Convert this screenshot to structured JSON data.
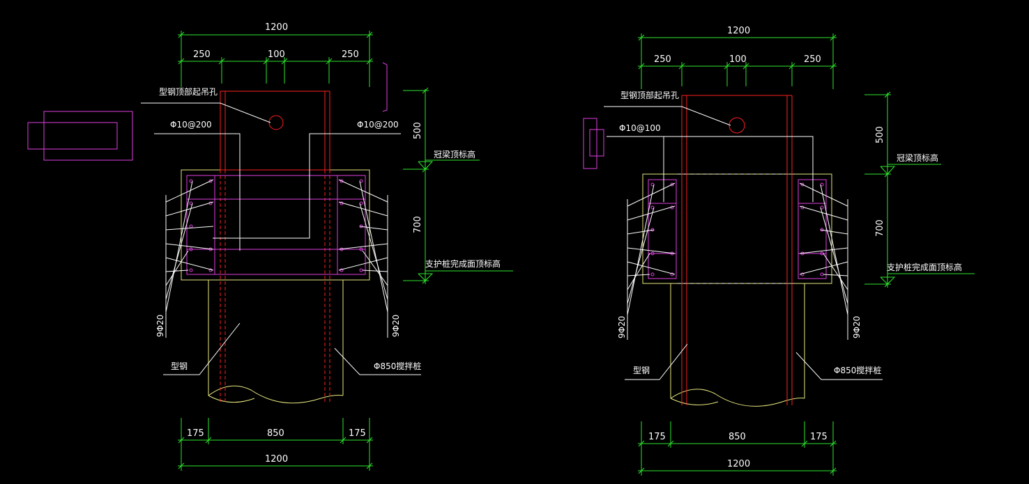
{
  "left": {
    "dim_top_total": "1200",
    "dim_top_a": "250",
    "dim_top_b": "100",
    "dim_top_c": "250",
    "dim_bot_a": "175",
    "dim_bot_b": "850",
    "dim_bot_c": "175",
    "dim_bot_total": "1200",
    "dim_right_upper": "500",
    "dim_right_lower": "700",
    "lift_hole": "型钢顶部起吊孔",
    "stirrup_left": "Φ10@200",
    "stirrup_right": "Φ10@200",
    "crown_beam_top": "冠梁顶标高",
    "pile_top": "支护桩完成面顶标高",
    "rebar_left": "9Φ20",
    "rebar_right": "9Φ20",
    "steel_section": "型钢",
    "mixing_pile": "Φ850搅拌桩"
  },
  "right": {
    "dim_top_total": "1200",
    "dim_top_a": "250",
    "dim_top_b": "100",
    "dim_top_c": "250",
    "dim_bot_a": "175",
    "dim_bot_b": "850",
    "dim_bot_c": "175",
    "dim_bot_total": "1200",
    "dim_right_upper": "500",
    "dim_right_lower": "700",
    "lift_hole": "型钢顶部起吊孔",
    "stirrup": "Φ10@100",
    "crown_beam_top": "冠梁顶标高",
    "pile_top": "支护桩完成面顶标高",
    "rebar_left": "9Φ20",
    "rebar_right": "9Φ20",
    "steel_section": "型钢",
    "mixing_pile": "Φ850搅拌桩"
  },
  "colors": {
    "background": "#000000",
    "dimension": "#2ee62e",
    "concrete": "#e8e880",
    "steel": "#ff2020",
    "rebar": "#e040e0",
    "leader": "#ffffff"
  }
}
